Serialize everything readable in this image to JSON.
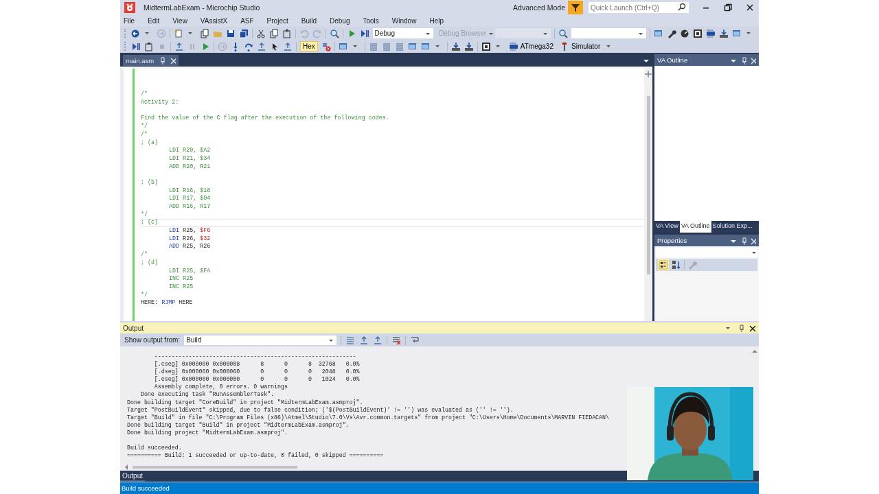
{
  "window": {
    "title": "MidtermLabExam - Microchip Studio",
    "mode": "Advanced Mode",
    "quick_launch": {
      "placeholder": "Quick Launch (Ctrl+Q)"
    }
  },
  "menu": [
    "File",
    "Edit",
    "View",
    "VAssistX",
    "ASF",
    "Project",
    "Build",
    "Debug",
    "Tools",
    "Window",
    "Help"
  ],
  "toolbar": {
    "configuration": "Debug",
    "debug_browser": {
      "label": "Debug Browser",
      "disabled": true
    },
    "hex": {
      "label": "Hex",
      "selected": true
    },
    "device": "ATmega32",
    "tool": "Simulator"
  },
  "document_tabs": [
    {
      "label": "main.asm",
      "selected": true
    }
  ],
  "editor": {
    "lines": [
      {
        "kind": "blank"
      },
      {
        "kind": "blank"
      },
      {
        "kind": "comment",
        "text": "/*"
      },
      {
        "kind": "comment",
        "text": "Activity 2:"
      },
      {
        "kind": "blank"
      },
      {
        "kind": "comment",
        "text": "Find the value of the C flag after the execution of the following codes."
      },
      {
        "kind": "comment",
        "text": "*/"
      },
      {
        "kind": "comment",
        "text": "/*"
      },
      {
        "kind": "comment",
        "text": "; (a)"
      },
      {
        "kind": "comment",
        "text": "LDI R20, $A2",
        "indented": true
      },
      {
        "kind": "comment",
        "text": "LDI R21, $34",
        "indented": true
      },
      {
        "kind": "comment",
        "text": "ADD R20, R21",
        "indented": true
      },
      {
        "kind": "blank"
      },
      {
        "kind": "comment",
        "text": "; (b)"
      },
      {
        "kind": "comment",
        "text": "LDI R16, $18",
        "indented": true
      },
      {
        "kind": "comment",
        "text": "LDI R17, $04",
        "indented": true
      },
      {
        "kind": "comment",
        "text": "ADD R16, R17",
        "indented": true
      },
      {
        "kind": "comment",
        "text": "*/"
      },
      {
        "kind": "comment",
        "text": "; (c)",
        "current": true
      },
      {
        "kind": "code",
        "indented": true,
        "tokens": [
          {
            "kind": "keyword",
            "text": "LDI"
          },
          {
            "kind": "plain",
            "text": " R25, "
          },
          {
            "kind": "number",
            "text": "$F6"
          }
        ]
      },
      {
        "kind": "code",
        "indented": true,
        "tokens": [
          {
            "kind": "keyword",
            "text": "LDI"
          },
          {
            "kind": "plain",
            "text": " R26, "
          },
          {
            "kind": "number",
            "text": "$32"
          }
        ]
      },
      {
        "kind": "code",
        "indented": true,
        "tokens": [
          {
            "kind": "keyword",
            "text": "ADD"
          },
          {
            "kind": "plain",
            "text": " R25, R26"
          }
        ]
      },
      {
        "kind": "comment",
        "text": "/*"
      },
      {
        "kind": "comment",
        "text": "; (d)"
      },
      {
        "kind": "comment",
        "text": "LDI R25, $FA",
        "indented": true
      },
      {
        "kind": "comment",
        "text": "INC R25",
        "indented": true
      },
      {
        "kind": "comment",
        "text": "INC R25",
        "indented": true
      },
      {
        "kind": "comment",
        "text": "*/"
      },
      {
        "kind": "code",
        "tokens": [
          {
            "kind": "plain",
            "text": "HERE: "
          },
          {
            "kind": "keyword",
            "text": "RJMP"
          },
          {
            "kind": "plain",
            "text": " HERE"
          }
        ]
      }
    ]
  },
  "va_outline": {
    "title": "VA Outline",
    "tabs": [
      {
        "label": "VA View",
        "selected": false
      },
      {
        "label": "VA Outline",
        "selected": true
      },
      {
        "label": "Solution Exp...",
        "selected": false
      }
    ]
  },
  "properties": {
    "title": "Properties"
  },
  "output": {
    "title": "Output",
    "show_from_label": "Show output from:",
    "source": "Build",
    "lines": [
      {
        "kind": "text",
        "text": "        -----------------------------------------------------------"
      },
      {
        "kind": "text",
        "text": "        [.cseg] 0x000000 0x000008      8      0      8  32768   0.0%"
      },
      {
        "kind": "text",
        "text": "        [.dseg] 0x000060 0x000060      0      0      0   2048   0.0%"
      },
      {
        "kind": "text",
        "text": "        [.eseg] 0x000000 0x000000      0      0      0   1024   0.0%"
      },
      {
        "kind": "text",
        "text": "        Assembly complete, 0 errors. 0 warnings"
      },
      {
        "kind": "text",
        "text": "    Done executing task \"RunAssemblerTask\"."
      },
      {
        "kind": "text",
        "text": "Done building target \"CoreBuild\" in project \"MidtermLabExam.asmproj\"."
      },
      {
        "kind": "text",
        "text": "Target \"PostBuildEvent\" skipped, due to false condition; ('$(PostBuildEvent)' != '') was evaluated as ('' != '')."
      },
      {
        "kind": "text",
        "text": "Target \"Build\" in file \"C:\\Program Files (x86)\\Atmel\\Studio\\7.0\\Vs\\Avr.common.targets\" from project \"C:\\Users\\Home\\Documents\\MARVIN FIEDACAN\\"
      },
      {
        "kind": "text",
        "text": "Done building target \"Build\" in project \"MidtermLabExam.asmproj\"."
      },
      {
        "kind": "text",
        "text": "Done building project \"MidtermLabExam.asmproj\"."
      },
      {
        "kind": "blank"
      },
      {
        "kind": "text",
        "text": "Build succeeded."
      },
      {
        "kind": "text",
        "text": "========== Build: 1 succeeded or up-to-date, 0 failed, 0 skipped =========="
      }
    ]
  },
  "bottom_tabs": [
    {
      "label": "Output",
      "selected": true
    }
  ],
  "status_bar": {
    "text": "Build succeeded"
  }
}
